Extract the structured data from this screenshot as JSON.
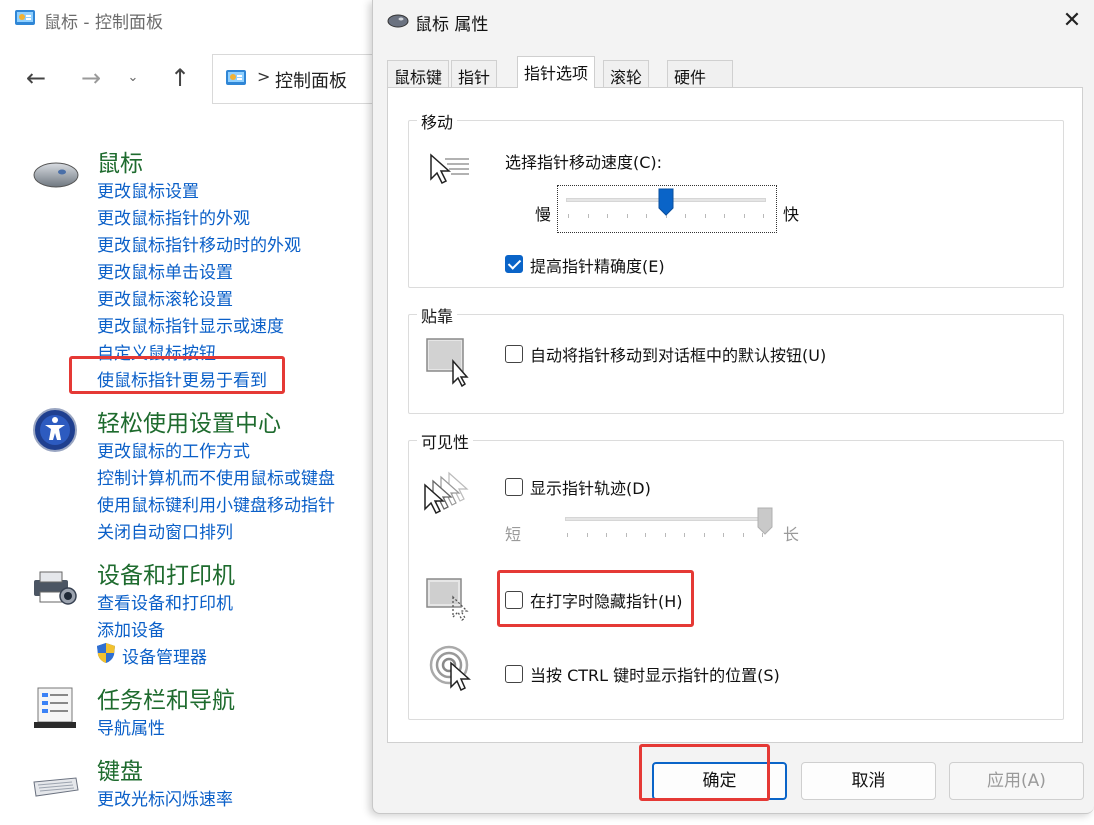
{
  "control_panel": {
    "title": "鼠标 - 控制面板",
    "address": {
      "separator": ">",
      "location": "控制面板"
    },
    "nav": {
      "back": "←",
      "forward": "→",
      "dropdown": "⌄",
      "up": "↑"
    },
    "sections": [
      {
        "title": "鼠标",
        "links": [
          "更改鼠标设置",
          "更改鼠标指针的外观",
          "更改鼠标指针移动时的外观",
          "更改鼠标单击设置",
          "更改鼠标滚轮设置",
          "更改鼠标指针显示或速度",
          "自定义鼠标按钮",
          "使鼠标指针更易于看到"
        ]
      },
      {
        "title": "轻松使用设置中心",
        "links": [
          "更改鼠标的工作方式",
          "控制计算机而不使用鼠标或键盘",
          "使用鼠标键利用小键盘移动指针",
          "关闭自动窗口排列"
        ]
      },
      {
        "title": "设备和打印机",
        "links": [
          "查看设备和打印机",
          "添加设备",
          "设备管理器"
        ]
      },
      {
        "title": "任务栏和导航",
        "links": [
          "导航属性"
        ]
      },
      {
        "title": "键盘",
        "links": [
          "更改光标闪烁速率"
        ]
      }
    ]
  },
  "dialog": {
    "title": "鼠标 属性",
    "close": "✕",
    "tabs": [
      "鼠标键",
      "指针",
      "指针选项",
      "滚轮",
      "硬件"
    ],
    "active_tab": 2,
    "motion": {
      "group_title": "移动",
      "speed_label": "选择指针移动速度(C):",
      "slow": "慢",
      "fast": "快",
      "speed_value": 0.5,
      "precision_label": "提高指针精确度(E)",
      "precision_checked": true
    },
    "snap": {
      "group_title": "贴靠",
      "snap_label": "自动将指针移动到对话框中的默认按钮(U)",
      "snap_checked": false
    },
    "visibility": {
      "group_title": "可见性",
      "trails_label": "显示指针轨迹(D)",
      "trails_checked": false,
      "short": "短",
      "long": "长",
      "trails_value": 1.0,
      "hide_label": "在打字时隐藏指针(H)",
      "hide_checked": false,
      "ctrl_label": "当按 CTRL 键时显示指针的位置(S)",
      "ctrl_checked": false
    },
    "buttons": {
      "ok": "确定",
      "cancel": "取消",
      "apply": "应用(A)"
    }
  },
  "colors": {
    "link": "#0a5fc8",
    "heading": "#1e6b2e",
    "accent": "#0a64c8",
    "highlight": "#e53935"
  }
}
